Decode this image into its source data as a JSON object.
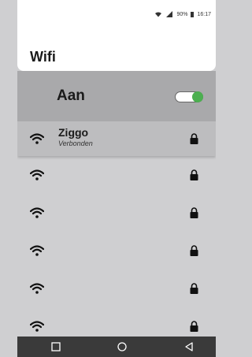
{
  "status_bar": {
    "battery": "90%",
    "time": "16:17",
    "icons": [
      "wifi-signal-icon",
      "cell-signal-icon",
      "battery-icon"
    ]
  },
  "header": {
    "title": "Wifi"
  },
  "wifi_toggle": {
    "label": "Aan",
    "state": "on",
    "accent_color": "#4caf50"
  },
  "networks": [
    {
      "name": "Ziggo",
      "status": "Verbonden",
      "connected": true,
      "locked": true
    },
    {
      "name": "",
      "status": "",
      "connected": false,
      "locked": true
    },
    {
      "name": "",
      "status": "",
      "connected": false,
      "locked": true
    },
    {
      "name": "",
      "status": "",
      "connected": false,
      "locked": true
    },
    {
      "name": "",
      "status": "",
      "connected": false,
      "locked": true
    },
    {
      "name": "",
      "status": "",
      "connected": false,
      "locked": true
    }
  ],
  "nav_bar": {
    "buttons": [
      "recents-square-icon",
      "home-circle-icon",
      "back-triangle-icon"
    ]
  }
}
